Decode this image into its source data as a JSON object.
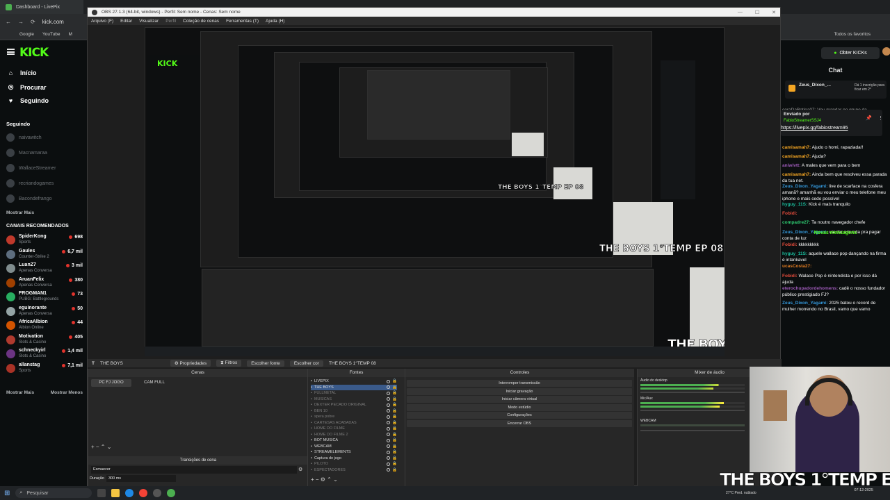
{
  "browser": {
    "tab_title": "Dashboard - LivePix",
    "address": "kick.com",
    "bookmarks": [
      "Google",
      "YouTube",
      "M"
    ],
    "bookmarks_right": "Todos os favoritos"
  },
  "kick": {
    "logo": "KICK",
    "nav": [
      {
        "icon": "home-icon",
        "label": "Início"
      },
      {
        "icon": "compass-icon",
        "label": "Procurar"
      },
      {
        "icon": "heart-icon",
        "label": "Seguindo"
      }
    ],
    "following_title": "Seguindo",
    "following": [
      "naivawitch",
      "Macnamaraa",
      "WallaceStreamer",
      "recriandogames",
      "Bacondefrango"
    ],
    "following_more": "Mostrar Mais",
    "recommended_title": "CANAIS RECOMENDADOS",
    "recommended": [
      {
        "name": "SpiderKong",
        "category": "Sports",
        "viewers": "698",
        "color": "#c0392b"
      },
      {
        "name": "Gaules",
        "category": "Counter-Strike 2",
        "viewers": "6,7 mil",
        "color": "#5d6d7e"
      },
      {
        "name": "LuanZ7",
        "category": "Apenas Conversa",
        "viewers": "3 mil",
        "color": "#7f8c8d"
      },
      {
        "name": "AruanFelix",
        "category": "Apenas Conversa",
        "viewers": "380",
        "color": "#a04000"
      },
      {
        "name": "FROGMAN1",
        "category": "PUBG: Battlegrounds",
        "viewers": "73",
        "color": "#27ae60"
      },
      {
        "name": "eguinorante",
        "category": "Apenas Conversa",
        "viewers": "50",
        "color": "#95a5a6"
      },
      {
        "name": "AfricaAlbion",
        "category": "Albion Online",
        "viewers": "44",
        "color": "#d35400"
      },
      {
        "name": "Motivation",
        "category": "Slots & Casino",
        "viewers": "405",
        "color": "#b03a2e"
      },
      {
        "name": "schneckyirl",
        "category": "Slots & Casino",
        "viewers": "1,4 mil",
        "color": "#6c3483"
      },
      {
        "name": "allanstag",
        "category": "Sports",
        "viewers": "7,1 mil",
        "color": "#a93226"
      }
    ],
    "show_more": "Mostrar Mais",
    "show_less": "Mostrar Menos"
  },
  "chat": {
    "obter_label": "Obter KICKs",
    "title": "Chat",
    "pinned_user": "Zeus_Dixon_...",
    "pinned_text": "Dá 1 inscrição para ficar em 2°",
    "sent_by": "Enviado por",
    "sent_user": "FabioStreamerSSJ4",
    "sent_link": "https://livepix.gg/fabiostream95",
    "partial_line": "coraDaBotina07: Vou mandar no grupo da",
    "new_messages": "Novas mensagens",
    "messages": [
      {
        "user": "camisamah7:",
        "text": "Ajudo o homi, rapaziada!!",
        "color": "#f5a623"
      },
      {
        "user": "camisamah7:",
        "text": "Ajuda?",
        "color": "#f5a623"
      },
      {
        "user": "aniwivtt:",
        "text": "A males que vem para o bem",
        "color": "#9b59b6"
      },
      {
        "user": "camisamah7:",
        "text": "Ainda bem que resolveu essa parada da tua net.",
        "color": "#f5a623"
      },
      {
        "user": "Zeus_Dixon_Yagami:",
        "text": "live de scarface na cosfera amanã? amanhã eu vou enviar o meu telefone meu iphone e mais cedo possível",
        "color": "#3498db"
      },
      {
        "user": "hyguy_11S:",
        "text": "Kick é mais tranquilo",
        "color": "#1abc9c"
      },
      {
        "user": "Fobidi:",
        "text": "",
        "color": "#e74c3c"
      },
      {
        "user": "compadre27:",
        "text": "Ta noutro navegador chefe",
        "color": "#2ecc71"
      },
      {
        "user": "Zeus_Dixon_Yagami:",
        "text": "vai dar a bunda pra pagar conta de luz",
        "color": "#3498db"
      },
      {
        "user": "Fobidi:",
        "text": "kkkkkkkkk",
        "color": "#e74c3c"
      },
      {
        "user": "hyguy_11S:",
        "text": "aquele wallace pop dançando na firma é intankavel",
        "color": "#1abc9c"
      },
      {
        "user": "ucasCosta27:",
        "text": "",
        "color": "#e67e22"
      },
      {
        "user": "Fobidi:",
        "text": "Walace Pop é nintendista e por isso dá ajuda",
        "color": "#e74c3c"
      },
      {
        "user": "eterochupadordehomens:",
        "text": "cadê o nosso fundador público prestigiado FJ?",
        "color": "#9b59b6"
      },
      {
        "user": "Zeus_Dixon_Yagami:",
        "text": "2025 batou o record de mulher morrendo no Brasil, vamo que vamo",
        "color": "#3498db"
      }
    ]
  },
  "obs": {
    "title": "OBS 27.1.3 (64-bit, windows) - Perfil: Sem nome - Cenas: Sem nome",
    "menu": [
      "Arquivo (F)",
      "Editar",
      "Visualizar",
      "Perfil",
      "Coleção de cenas",
      "Ferramentas (T)",
      "Ajuda (H)"
    ],
    "toolbar": {
      "source_name": "THE BOYS",
      "properties": "Propriedades",
      "filters": "Filtros",
      "choose_font": "Escolher fonte",
      "choose_color": "Escolher cor",
      "text_value": "THE BOYS 1°TEMP 08"
    },
    "scenes_title": "Cenas",
    "scenes": [
      "PC FJ JOGO",
      "CAM FULL"
    ],
    "sources_title": "Fontes",
    "sources": [
      {
        "name": "LIVEPIX",
        "active": true
      },
      {
        "name": "THE BOYS",
        "active": true,
        "selected": true
      },
      {
        "name": "FULLMETAL",
        "active": false
      },
      {
        "name": "MUSICAS",
        "active": false
      },
      {
        "name": "DEXTER PECADO ORIGINAL",
        "active": false
      },
      {
        "name": "BEN 10",
        "active": false
      },
      {
        "name": "spera pobre",
        "active": false
      },
      {
        "name": "CARTESAS ACABADAS",
        "active": false
      },
      {
        "name": "HOME DO FILME",
        "active": false
      },
      {
        "name": "HOME DO FILME 2",
        "active": false
      },
      {
        "name": "BOT MUSICA",
        "active": true
      },
      {
        "name": "WEBCAM",
        "active": true
      },
      {
        "name": "STREAMELEMENTS",
        "active": true
      },
      {
        "name": "Captura de jogo",
        "active": true
      },
      {
        "name": "PILOTO",
        "active": false
      },
      {
        "name": "ESPECTADORES",
        "active": false
      }
    ],
    "controls_title": "Controles",
    "controls": [
      "Interromper transmissão",
      "Iniciar gravação",
      "Iniciar câmera virtual",
      "Modo estúdio",
      "Configurações",
      "Encerrar OBS"
    ],
    "mixer_title": "Mixer de áudio",
    "mixer": [
      "Áudio do desktop",
      "Mic/Aux",
      "WEBCAM"
    ],
    "transitions_title": "Transições de cena",
    "transition": "Esmaecer",
    "duration_label": "Duração",
    "duration": "300 ms"
  },
  "overlay": {
    "title_text": "THE BOYS 1°TEMP EP 08"
  },
  "taskbar": {
    "search": "Pesquisar",
    "weather": "27°C Pred. nublado",
    "time": "07:12:2025"
  }
}
